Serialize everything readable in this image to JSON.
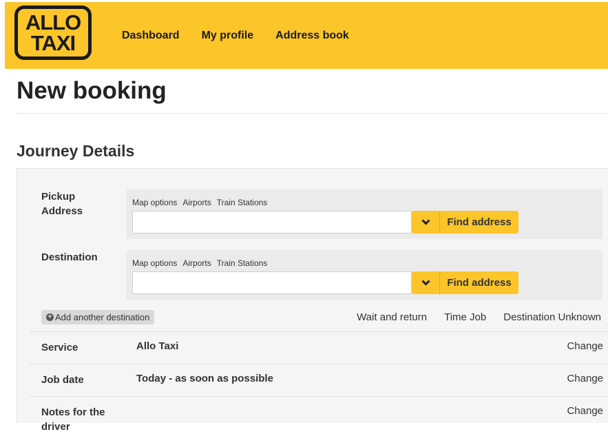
{
  "header": {
    "logo_line1": "ALLO",
    "logo_line2": "TAXI",
    "nav": [
      "Dashboard",
      "My profile",
      "Address book"
    ]
  },
  "page_title": "New booking",
  "section_title": "Journey Details",
  "pickup": {
    "label_line1": "Pickup",
    "label_line2": "Address",
    "links": [
      "Map options",
      "Airports",
      "Train Stations"
    ],
    "value": "",
    "find_label": "Find address"
  },
  "destination": {
    "label": "Destination",
    "links": [
      "Map options",
      "Airports",
      "Train Stations"
    ],
    "value": "",
    "find_label": "Find address"
  },
  "add_destination_label": "Add another destination",
  "options": [
    "Wait and return",
    "Time Job",
    "Destination Unknown"
  ],
  "details": [
    {
      "label": "Service",
      "value": "Allo Taxi",
      "action": "Change"
    },
    {
      "label": "Job date",
      "value": "Today - as soon as possible",
      "action": "Change"
    },
    {
      "label": "Notes for the driver",
      "value": "",
      "action": "Change"
    }
  ],
  "colors": {
    "brand_yellow": "#fcc52a",
    "panel_bg": "#f5f5f5"
  },
  "icons": {
    "dropdown": "chevron-down-icon",
    "add": "plus-circle-icon"
  }
}
